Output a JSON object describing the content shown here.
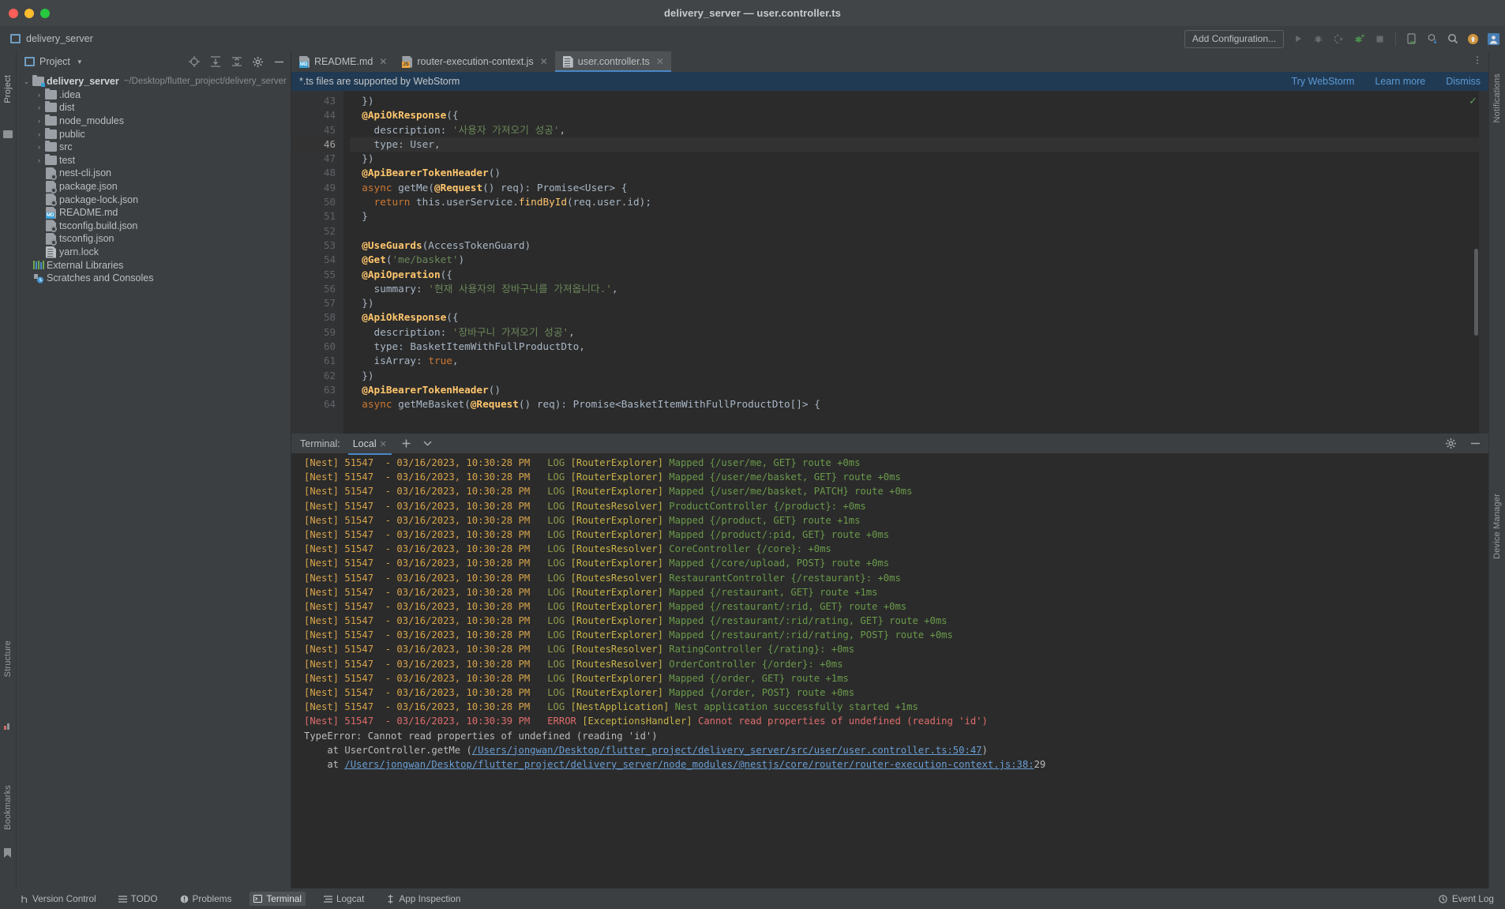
{
  "window": {
    "title": "delivery_server — user.controller.ts",
    "project_chip": "delivery_server"
  },
  "toolbar": {
    "add_configuration": "Add Configuration...",
    "icons": [
      "run-icon",
      "debug-icon",
      "run-coverage-icon",
      "profiler-icon",
      "stop-icon",
      "device-manager-icon",
      "sdk-manager-icon",
      "search-everywhere-icon",
      "updates-icon",
      "account-icon"
    ]
  },
  "project_panel": {
    "title": "Project",
    "header_icons": [
      "locate-icon",
      "expand-all-icon",
      "collapse-all-icon",
      "settings-icon",
      "hide-icon"
    ],
    "tree": [
      {
        "label": "delivery_server",
        "path": "~/Desktop/flutter_project/delivery_server",
        "type": "root",
        "arrow": "expanded",
        "indent": 0
      },
      {
        "label": ".idea",
        "type": "folder",
        "arrow": "collapsed",
        "indent": 1
      },
      {
        "label": "dist",
        "type": "folder",
        "arrow": "collapsed",
        "indent": 1
      },
      {
        "label": "node_modules",
        "type": "folder",
        "arrow": "collapsed",
        "indent": 1
      },
      {
        "label": "public",
        "type": "folder",
        "arrow": "collapsed",
        "indent": 1
      },
      {
        "label": "src",
        "type": "folder",
        "arrow": "collapsed",
        "indent": 1
      },
      {
        "label": "test",
        "type": "folder",
        "arrow": "collapsed",
        "indent": 1
      },
      {
        "label": "nest-cli.json",
        "type": "json",
        "arrow": "none",
        "indent": 1
      },
      {
        "label": "package.json",
        "type": "json",
        "arrow": "none",
        "indent": 1
      },
      {
        "label": "package-lock.json",
        "type": "json",
        "arrow": "none",
        "indent": 1
      },
      {
        "label": "README.md",
        "type": "md",
        "arrow": "none",
        "indent": 1
      },
      {
        "label": "tsconfig.build.json",
        "type": "json",
        "arrow": "none",
        "indent": 1
      },
      {
        "label": "tsconfig.json",
        "type": "json",
        "arrow": "none",
        "indent": 1
      },
      {
        "label": "yarn.lock",
        "type": "lock",
        "arrow": "none",
        "indent": 1
      },
      {
        "label": "External Libraries",
        "type": "libs",
        "arrow": "none",
        "indent": 0
      },
      {
        "label": "Scratches and Consoles",
        "type": "scratch",
        "arrow": "none",
        "indent": 0
      }
    ]
  },
  "rails": {
    "left": [
      "Project",
      "Structure",
      "Bookmarks"
    ],
    "right": [
      "Notifications",
      "Device Manager"
    ]
  },
  "tabs": [
    {
      "label": "README.md",
      "icon": "md-file-icon",
      "active": false
    },
    {
      "label": "router-execution-context.js",
      "icon": "js-file-icon",
      "active": false
    },
    {
      "label": "user.controller.ts",
      "icon": "ts-file-icon",
      "active": true
    }
  ],
  "banner": {
    "message": "*.ts files are supported by WebStorm",
    "links": [
      "Try WebStorm",
      "Learn more",
      "Dismiss"
    ]
  },
  "editor": {
    "current_line": 46,
    "lines": [
      {
        "n": 43,
        "tokens": [
          {
            "t": "  })",
            "c": "plain"
          }
        ]
      },
      {
        "n": 44,
        "tokens": [
          {
            "t": "  ",
            "c": "plain"
          },
          {
            "t": "@ApiOkResponse",
            "c": "dec"
          },
          {
            "t": "({",
            "c": "plain"
          }
        ]
      },
      {
        "n": 45,
        "tokens": [
          {
            "t": "    description: ",
            "c": "plain"
          },
          {
            "t": "'사용자 가져오기 성공'",
            "c": "str"
          },
          {
            "t": ",",
            "c": "plain"
          }
        ]
      },
      {
        "n": 46,
        "tokens": [
          {
            "t": "    type: User,",
            "c": "plain"
          }
        ]
      },
      {
        "n": 47,
        "tokens": [
          {
            "t": "  })",
            "c": "plain"
          }
        ]
      },
      {
        "n": 48,
        "tokens": [
          {
            "t": "  ",
            "c": "plain"
          },
          {
            "t": "@ApiBearerTokenHeader",
            "c": "dec"
          },
          {
            "t": "()",
            "c": "plain"
          }
        ]
      },
      {
        "n": 49,
        "tokens": [
          {
            "t": "  ",
            "c": "plain"
          },
          {
            "t": "async",
            "c": "kw"
          },
          {
            "t": " getMe(",
            "c": "plain"
          },
          {
            "t": "@Request",
            "c": "dec"
          },
          {
            "t": "() req): Promise<User> {",
            "c": "plain"
          }
        ]
      },
      {
        "n": 50,
        "tokens": [
          {
            "t": "    ",
            "c": "plain"
          },
          {
            "t": "return",
            "c": "kw"
          },
          {
            "t": " this.userService.",
            "c": "plain"
          },
          {
            "t": "findById",
            "c": "fn"
          },
          {
            "t": "(req.user.id);",
            "c": "plain"
          }
        ]
      },
      {
        "n": 51,
        "tokens": [
          {
            "t": "  }",
            "c": "plain"
          }
        ]
      },
      {
        "n": 52,
        "tokens": [
          {
            "t": "",
            "c": "plain"
          }
        ]
      },
      {
        "n": 53,
        "tokens": [
          {
            "t": "  ",
            "c": "plain"
          },
          {
            "t": "@UseGuards",
            "c": "dec"
          },
          {
            "t": "(AccessTokenGuard)",
            "c": "plain"
          }
        ]
      },
      {
        "n": 54,
        "tokens": [
          {
            "t": "  ",
            "c": "plain"
          },
          {
            "t": "@Get",
            "c": "dec"
          },
          {
            "t": "(",
            "c": "plain"
          },
          {
            "t": "'me/basket'",
            "c": "str"
          },
          {
            "t": ")",
            "c": "plain"
          }
        ]
      },
      {
        "n": 55,
        "tokens": [
          {
            "t": "  ",
            "c": "plain"
          },
          {
            "t": "@ApiOperation",
            "c": "dec"
          },
          {
            "t": "({",
            "c": "plain"
          }
        ]
      },
      {
        "n": 56,
        "tokens": [
          {
            "t": "    summary: ",
            "c": "plain"
          },
          {
            "t": "'현재 사용자의 장바구니를 가져옵니다.'",
            "c": "str"
          },
          {
            "t": ",",
            "c": "plain"
          }
        ]
      },
      {
        "n": 57,
        "tokens": [
          {
            "t": "  })",
            "c": "plain"
          }
        ]
      },
      {
        "n": 58,
        "tokens": [
          {
            "t": "  ",
            "c": "plain"
          },
          {
            "t": "@ApiOkResponse",
            "c": "dec"
          },
          {
            "t": "({",
            "c": "plain"
          }
        ]
      },
      {
        "n": 59,
        "tokens": [
          {
            "t": "    description: ",
            "c": "plain"
          },
          {
            "t": "'장바구니 가져오기 성공'",
            "c": "str"
          },
          {
            "t": ",",
            "c": "plain"
          }
        ]
      },
      {
        "n": 60,
        "tokens": [
          {
            "t": "    type: BasketItemWithFullProductDto,",
            "c": "plain"
          }
        ]
      },
      {
        "n": 61,
        "tokens": [
          {
            "t": "    isArray: ",
            "c": "plain"
          },
          {
            "t": "true",
            "c": "kw"
          },
          {
            "t": ",",
            "c": "plain"
          }
        ]
      },
      {
        "n": 62,
        "tokens": [
          {
            "t": "  })",
            "c": "plain"
          }
        ]
      },
      {
        "n": 63,
        "tokens": [
          {
            "t": "  ",
            "c": "plain"
          },
          {
            "t": "@ApiBearerTokenHeader",
            "c": "dec"
          },
          {
            "t": "()",
            "c": "plain"
          }
        ]
      },
      {
        "n": 64,
        "tokens": [
          {
            "t": "  ",
            "c": "plain"
          },
          {
            "t": "async",
            "c": "kw"
          },
          {
            "t": " getMeBasket(",
            "c": "plain"
          },
          {
            "t": "@Request",
            "c": "dec"
          },
          {
            "t": "() req): Promise<BasketItemWithFullProductDto[]> {",
            "c": "plain"
          }
        ]
      }
    ]
  },
  "terminal": {
    "label": "Terminal:",
    "tab": "Local",
    "add_icon": "plus-icon",
    "chevron_icon": "chevron-down-icon",
    "settings_icon": "gear-icon",
    "hide_icon": "minimize-icon",
    "lines": [
      {
        "prefix": "[Nest] 51547  - 03/16/2023, 10:30:28 PM",
        "level": "LOG",
        "ctx": "[RouterExplorer]",
        "msg": "Mapped {/user/me, GET} route +0ms",
        "kind": "log"
      },
      {
        "prefix": "[Nest] 51547  - 03/16/2023, 10:30:28 PM",
        "level": "LOG",
        "ctx": "[RouterExplorer]",
        "msg": "Mapped {/user/me/basket, GET} route +0ms",
        "kind": "log"
      },
      {
        "prefix": "[Nest] 51547  - 03/16/2023, 10:30:28 PM",
        "level": "LOG",
        "ctx": "[RouterExplorer]",
        "msg": "Mapped {/user/me/basket, PATCH} route +0ms",
        "kind": "log"
      },
      {
        "prefix": "[Nest] 51547  - 03/16/2023, 10:30:28 PM",
        "level": "LOG",
        "ctx": "[RoutesResolver]",
        "msg": "ProductController {/product}: +0ms",
        "kind": "log"
      },
      {
        "prefix": "[Nest] 51547  - 03/16/2023, 10:30:28 PM",
        "level": "LOG",
        "ctx": "[RouterExplorer]",
        "msg": "Mapped {/product, GET} route +1ms",
        "kind": "log"
      },
      {
        "prefix": "[Nest] 51547  - 03/16/2023, 10:30:28 PM",
        "level": "LOG",
        "ctx": "[RouterExplorer]",
        "msg": "Mapped {/product/:pid, GET} route +0ms",
        "kind": "log"
      },
      {
        "prefix": "[Nest] 51547  - 03/16/2023, 10:30:28 PM",
        "level": "LOG",
        "ctx": "[RoutesResolver]",
        "msg": "CoreController {/core}: +0ms",
        "kind": "log"
      },
      {
        "prefix": "[Nest] 51547  - 03/16/2023, 10:30:28 PM",
        "level": "LOG",
        "ctx": "[RouterExplorer]",
        "msg": "Mapped {/core/upload, POST} route +0ms",
        "kind": "log"
      },
      {
        "prefix": "[Nest] 51547  - 03/16/2023, 10:30:28 PM",
        "level": "LOG",
        "ctx": "[RoutesResolver]",
        "msg": "RestaurantController {/restaurant}: +0ms",
        "kind": "log"
      },
      {
        "prefix": "[Nest] 51547  - 03/16/2023, 10:30:28 PM",
        "level": "LOG",
        "ctx": "[RouterExplorer]",
        "msg": "Mapped {/restaurant, GET} route +1ms",
        "kind": "log"
      },
      {
        "prefix": "[Nest] 51547  - 03/16/2023, 10:30:28 PM",
        "level": "LOG",
        "ctx": "[RouterExplorer]",
        "msg": "Mapped {/restaurant/:rid, GET} route +0ms",
        "kind": "log"
      },
      {
        "prefix": "[Nest] 51547  - 03/16/2023, 10:30:28 PM",
        "level": "LOG",
        "ctx": "[RouterExplorer]",
        "msg": "Mapped {/restaurant/:rid/rating, GET} route +0ms",
        "kind": "log"
      },
      {
        "prefix": "[Nest] 51547  - 03/16/2023, 10:30:28 PM",
        "level": "LOG",
        "ctx": "[RouterExplorer]",
        "msg": "Mapped {/restaurant/:rid/rating, POST} route +0ms",
        "kind": "log"
      },
      {
        "prefix": "[Nest] 51547  - 03/16/2023, 10:30:28 PM",
        "level": "LOG",
        "ctx": "[RoutesResolver]",
        "msg": "RatingController {/rating}: +0ms",
        "kind": "log"
      },
      {
        "prefix": "[Nest] 51547  - 03/16/2023, 10:30:28 PM",
        "level": "LOG",
        "ctx": "[RoutesResolver]",
        "msg": "OrderController {/order}: +0ms",
        "kind": "log"
      },
      {
        "prefix": "[Nest] 51547  - 03/16/2023, 10:30:28 PM",
        "level": "LOG",
        "ctx": "[RouterExplorer]",
        "msg": "Mapped {/order, GET} route +1ms",
        "kind": "log"
      },
      {
        "prefix": "[Nest] 51547  - 03/16/2023, 10:30:28 PM",
        "level": "LOG",
        "ctx": "[RouterExplorer]",
        "msg": "Mapped {/order, POST} route +0ms",
        "kind": "log"
      },
      {
        "prefix": "[Nest] 51547  - 03/16/2023, 10:30:28 PM",
        "level": "LOG",
        "ctx": "[NestApplication]",
        "msg": "Nest application successfully started +1ms",
        "kind": "log"
      },
      {
        "prefix": "[Nest] 51547  - 03/16/2023, 10:30:39 PM",
        "level": "ERROR",
        "ctx": "[ExceptionsHandler]",
        "msg": "Cannot read properties of undefined (reading 'id')",
        "kind": "error"
      }
    ],
    "stack": [
      {
        "kind": "plain",
        "text": "TypeError: Cannot read properties of undefined (reading 'id')"
      },
      {
        "kind": "at_link",
        "pre": "    at UserController.getMe (",
        "link": "/Users/jongwan/Desktop/flutter_project/delivery_server/src/user/user.controller.ts:50:47",
        "post": ")"
      },
      {
        "kind": "at_link",
        "pre": "    at ",
        "link": "/Users/jongwan/Desktop/flutter_project/delivery_server/node_modules/@nestjs/core/router/router-execution-context.js:38:",
        "post": "29"
      }
    ]
  },
  "statusbar": {
    "items": [
      {
        "label": "Version Control",
        "icon": "branch-icon",
        "active": false
      },
      {
        "label": "TODO",
        "icon": "list-icon",
        "active": false
      },
      {
        "label": "Problems",
        "icon": "warning-icon",
        "active": false
      },
      {
        "label": "Terminal",
        "icon": "terminal-icon",
        "active": true
      },
      {
        "label": "Logcat",
        "icon": "logcat-icon",
        "active": false
      },
      {
        "label": "App Inspection",
        "icon": "inspection-icon",
        "active": false
      }
    ],
    "right": {
      "label": "Event Log",
      "icon": "event-log-icon"
    }
  }
}
